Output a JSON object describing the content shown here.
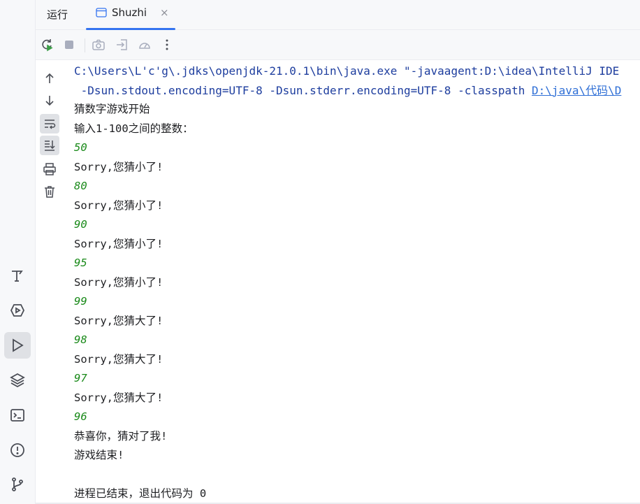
{
  "header": {
    "run_label": "运行",
    "tab_label": "Shuzhi",
    "tab_close": "×"
  },
  "colors": {
    "accent": "#3574f0",
    "command_text": "#1d3d9e",
    "user_input": "#1a8a1a",
    "link": "#2f6fd6"
  },
  "toolbar_icons": [
    "rerun-icon",
    "stop-icon",
    "camera-icon",
    "import-icon",
    "dashboard-icon",
    "more-icon"
  ],
  "gutter_icons": [
    "arrow-up-icon",
    "arrow-down-icon",
    "soft-wrap-icon",
    "scroll-to-end-icon",
    "print-icon",
    "trash-icon"
  ],
  "left_strip_icons": [
    "build-icon",
    "services-icon",
    "run-icon",
    "layers-icon",
    "terminal-icon",
    "problems-icon",
    "git-icon"
  ],
  "console": {
    "cmd_line1": "C:\\Users\\L'c'g\\.jdks\\openjdk-21.0.1\\bin\\java.exe \"-javaagent:D:\\idea\\IntelliJ IDE",
    "cmd_line2_prefix": " -Dsun.stdout.encoding=UTF-8 -Dsun.stderr.encoding=UTF-8 -classpath ",
    "cmd_line2_link": "D:\\java\\代码\\D",
    "lines": [
      {
        "text": "猜数字游戏开始",
        "kind": "out"
      },
      {
        "text": "输入1-100之间的整数：",
        "kind": "out"
      },
      {
        "text": "50",
        "kind": "input"
      },
      {
        "text": "Sorry,您猜小了!",
        "kind": "out"
      },
      {
        "text": "80",
        "kind": "input"
      },
      {
        "text": "Sorry,您猜小了!",
        "kind": "out"
      },
      {
        "text": "90",
        "kind": "input"
      },
      {
        "text": "Sorry,您猜小了!",
        "kind": "out"
      },
      {
        "text": "95",
        "kind": "input"
      },
      {
        "text": "Sorry,您猜小了!",
        "kind": "out"
      },
      {
        "text": "99",
        "kind": "input"
      },
      {
        "text": "Sorry,您猜大了!",
        "kind": "out"
      },
      {
        "text": "98",
        "kind": "input"
      },
      {
        "text": "Sorry,您猜大了!",
        "kind": "out"
      },
      {
        "text": "97",
        "kind": "input"
      },
      {
        "text": "Sorry,您猜大了!",
        "kind": "out"
      },
      {
        "text": "96",
        "kind": "input"
      },
      {
        "text": "恭喜你，猜对了我!",
        "kind": "out"
      },
      {
        "text": "游戏结束!",
        "kind": "out"
      },
      {
        "text": "",
        "kind": "out"
      },
      {
        "text": "进程已结束，退出代码为 0",
        "kind": "out"
      }
    ]
  }
}
